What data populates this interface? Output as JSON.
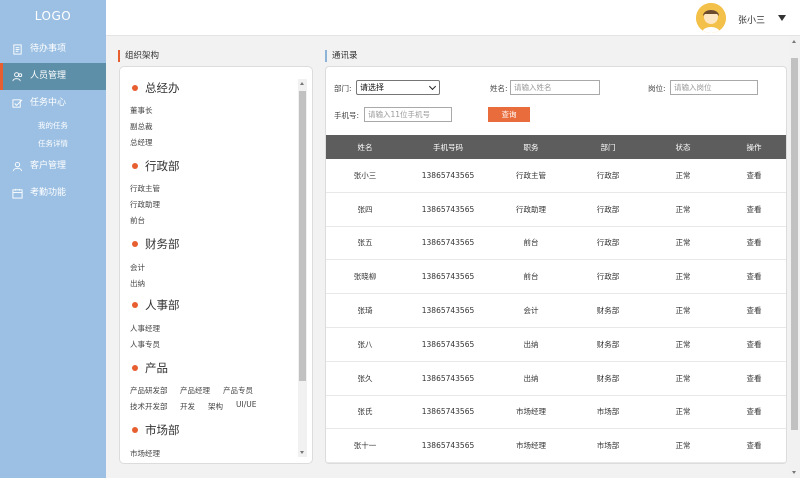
{
  "sidebar": {
    "logo": "LOGO",
    "items": [
      {
        "label": "待办事项",
        "icon": "document-icon"
      },
      {
        "label": "人员管理",
        "icon": "users-icon",
        "active": true
      },
      {
        "label": "任务中心",
        "icon": "task-icon"
      },
      {
        "label": "客户管理",
        "icon": "customer-icon"
      },
      {
        "label": "考勤功能",
        "icon": "calendar-icon"
      }
    ],
    "task_subitems": [
      "我的任务",
      "任务详情"
    ]
  },
  "header": {
    "username": "张小三",
    "avatar_icon": "user-avatar-icon"
  },
  "org": {
    "title": "组织架构",
    "departments": [
      {
        "name": "总经办",
        "roles": [
          "董事长",
          "副总裁",
          "总经理"
        ]
      },
      {
        "name": "行政部",
        "roles": [
          "行政主管",
          "行政助理",
          "前台"
        ]
      },
      {
        "name": "财务部",
        "roles": [
          "会计",
          "出纳"
        ]
      },
      {
        "name": "人事部",
        "roles": [
          "人事经理",
          "人事专员"
        ]
      },
      {
        "name": "产品",
        "roles": [
          "产品研发部",
          "产品经理",
          "产品专员",
          "技术开发部",
          "开发",
          "架构",
          "UI/UE"
        ]
      },
      {
        "name": "市场部",
        "roles": [
          "市场经理"
        ]
      }
    ]
  },
  "address_book": {
    "title": "通讯录",
    "filters": {
      "dept_label": "部门:",
      "dept_value": "请选择",
      "name_label": "姓名:",
      "name_placeholder": "请输入姓名",
      "post_label": "岗位:",
      "post_placeholder": "请输入岗位",
      "phone_label": "手机号:",
      "phone_placeholder": "请输入11位手机号",
      "query_label": "查询"
    },
    "columns": [
      "姓名",
      "手机号码",
      "职务",
      "部门",
      "状态",
      "操作"
    ],
    "rows": [
      [
        "张小三",
        "13865743565",
        "行政主管",
        "行政部",
        "正常",
        "查看"
      ],
      [
        "张四",
        "13865743565",
        "行政助理",
        "行政部",
        "正常",
        "查看"
      ],
      [
        "张五",
        "13865743565",
        "前台",
        "行政部",
        "正常",
        "查看"
      ],
      [
        "张晓柳",
        "13865743565",
        "前台",
        "行政部",
        "正常",
        "查看"
      ],
      [
        "张琦",
        "13865743565",
        "会计",
        "财务部",
        "正常",
        "查看"
      ],
      [
        "张八",
        "13865743565",
        "出纳",
        "财务部",
        "正常",
        "查看"
      ],
      [
        "张久",
        "13865743565",
        "出纳",
        "财务部",
        "正常",
        "查看"
      ],
      [
        "张氏",
        "13865743565",
        "市场经理",
        "市场部",
        "正常",
        "查看"
      ],
      [
        "张十一",
        "13865743565",
        "市场经理",
        "市场部",
        "正常",
        "查看"
      ]
    ]
  },
  "colors": {
    "sidebar_bg": "#9cc0e3",
    "sidebar_active": "#5d8fa8",
    "accent": "#e75f30",
    "table_header": "#5d5d5d",
    "query_button": "#e96c3c"
  }
}
